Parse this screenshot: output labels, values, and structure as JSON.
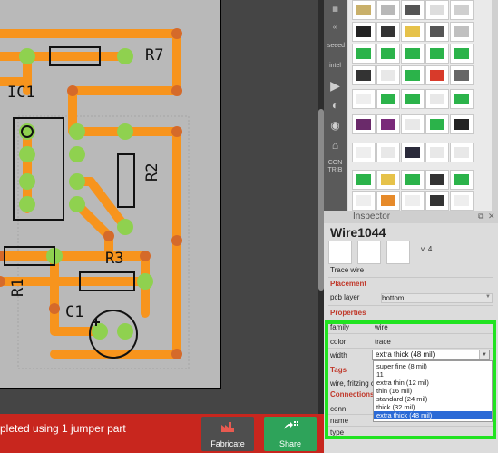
{
  "pcb": {
    "labels": {
      "r7": "R7",
      "ic1": "IC1",
      "r2": "R2",
      "r3": "R3",
      "r1": "R1",
      "c1": "C1"
    }
  },
  "status": {
    "message": "pleted using 1 jumper part",
    "fabricate_label": "Fabricate",
    "share_label": "Share"
  },
  "parts_bin": {
    "sidebar_items": [
      "bin-icon",
      "arduino-icon",
      "sparkfun-icon",
      "seeed-icon",
      "intel-icon",
      "play-icon",
      "edison-icon",
      "snootlab-icon",
      "contrib-icon"
    ],
    "seeed_label": "seeed",
    "intel_label": "intel",
    "contrib_label": "CON TRIB"
  },
  "inspector": {
    "header": "Inspector",
    "title": "Wire1044",
    "version": "v. 4",
    "description": "Trace wire",
    "placement_heading": "Placement",
    "pcb_layer_label": "pcb layer",
    "pcb_layer_value": "bottom",
    "properties_heading": "Properties",
    "family_label": "family",
    "family_value": "wire",
    "color_label": "color",
    "color_value": "trace",
    "width_label": "width",
    "width_value": "extra thick (48 mil)",
    "width_options": [
      "super fine (8 mil)",
      "11",
      "extra thin (12 mil)",
      "thin (16 mil)",
      "standard (24 mil)",
      "thick (32 mil)",
      "extra thick (48 mil)"
    ],
    "tags_heading": "Tags",
    "tags_value": "wire, fritzing c",
    "connections_heading": "Connections",
    "conn_label": "conn.",
    "name_label": "name",
    "type_label": "type"
  },
  "colors": {
    "trace": "#f7941d",
    "pad": "#8fd14f",
    "highlight": "#21e321",
    "fabricate_button": "#c8261e",
    "share_button": "#2ea35a",
    "selection": "#2b6ad6"
  }
}
